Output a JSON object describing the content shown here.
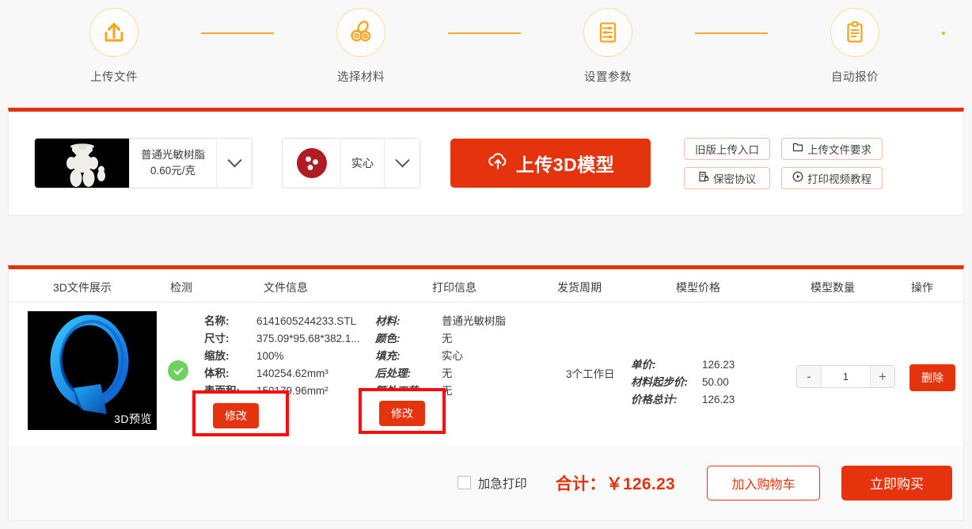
{
  "stepper": {
    "steps": [
      {
        "label": "上传文件",
        "icon": "upload-box-icon"
      },
      {
        "label": "选择材料",
        "icon": "material-rolls-icon"
      },
      {
        "label": "设置参数",
        "icon": "settings-sliders-icon"
      },
      {
        "label": "自动报价",
        "icon": "clipboard-quote-icon"
      }
    ],
    "line_color": "#f0a830"
  },
  "upload_bar": {
    "material": {
      "name": "普通光敏树脂",
      "price": "0.60元/克",
      "thumb_alt": "resin-bear-model"
    },
    "fill": {
      "value": "实心",
      "icon": "solid-fill-ball-icon",
      "icon_color": "#b01c23"
    },
    "upload_button": "上传3D模型",
    "upload_icon": "cloud-upload-icon",
    "links": [
      {
        "label": "旧版上传入口",
        "icon": ""
      },
      {
        "label": "上传文件要求",
        "icon": "file-icon"
      },
      {
        "label": "保密协议",
        "icon": "document-lock-icon"
      },
      {
        "label": "打印视频教程",
        "icon": "play-circle-icon"
      }
    ],
    "accent": "#e5330d"
  },
  "table": {
    "headers": [
      "3D文件展示",
      "检测",
      "文件信息",
      "打印信息",
      "发货周期",
      "模型价格",
      "模型数量",
      "操作"
    ],
    "row": {
      "preview_label": "3D预览",
      "status_icon": "check-circle-icon",
      "file_info": [
        {
          "key": "名称:",
          "value": "6141605244233.STL"
        },
        {
          "key": "尺寸:",
          "value": "375.09*95.68*382.1..."
        },
        {
          "key": "缩放:",
          "value": "100%"
        },
        {
          "key": "体积:",
          "value": "140254.62mm³"
        },
        {
          "key": "表面积:",
          "value": "150179.96mm²"
        }
      ],
      "file_info_modify": "修改",
      "print_info": [
        {
          "key": "材料:",
          "value": "普通光敏树脂"
        },
        {
          "key": "颜色:",
          "value": "无"
        },
        {
          "key": "填充:",
          "value": "实心"
        },
        {
          "key": "后处理:",
          "value": "无"
        },
        {
          "key": "额外工艺:",
          "value": "无"
        }
      ],
      "print_info_modify": "修改",
      "delivery": "3个工作日",
      "price_info": [
        {
          "key": "单价:",
          "value": "126.23"
        },
        {
          "key": "材料起步价:",
          "value": "50.00"
        },
        {
          "key": "价格总计:",
          "value": "126.23"
        }
      ],
      "quantity": {
        "minus": "-",
        "value": "1",
        "plus": "+"
      },
      "delete_button": "删除"
    }
  },
  "footer": {
    "rush_label": "加急打印",
    "rush_checked": false,
    "total_label": "合计：",
    "total_value": "￥126.23",
    "add_to_cart": "加入购物车",
    "buy_now": "立即购买"
  },
  "annotations": {
    "highlight_color": "#fb0b0b",
    "boxes": 2
  }
}
